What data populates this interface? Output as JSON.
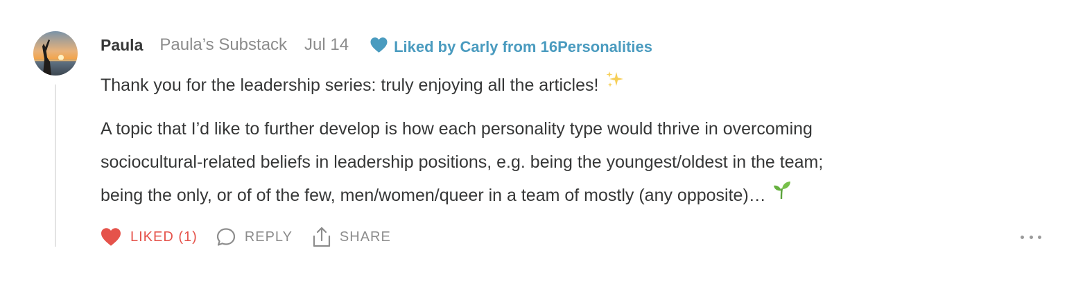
{
  "comment": {
    "author": "Paula",
    "publication": "Paula’s Substack",
    "date": "Jul 14",
    "liked_by": "Liked by Carly from 16Personalities",
    "paragraph1": "Thank you for the leadership series: truly enjoying all the articles!",
    "paragraph1_emoji": "sparkles-emoji",
    "paragraph2_lines": [
      "A topic that I’d like to further develop is how each personality type would thrive in overcoming",
      "sociocultural-related beliefs in leadership positions, e.g. being the youngest/oldest in the team;",
      "being the only, or of of the few, men/women/queer in a team of mostly (any opposite)…"
    ],
    "paragraph2_emoji": "seedling-emoji"
  },
  "actions": {
    "like_label": "LIKED (1)",
    "reply_label": "REPLY",
    "share_label": "SHARE",
    "more_icon": "ellipsis-icon"
  },
  "colors": {
    "liked_red": "#e5534b",
    "liked_by_blue": "#4a9bbf",
    "text": "#363737",
    "muted": "#8c8c8c"
  }
}
